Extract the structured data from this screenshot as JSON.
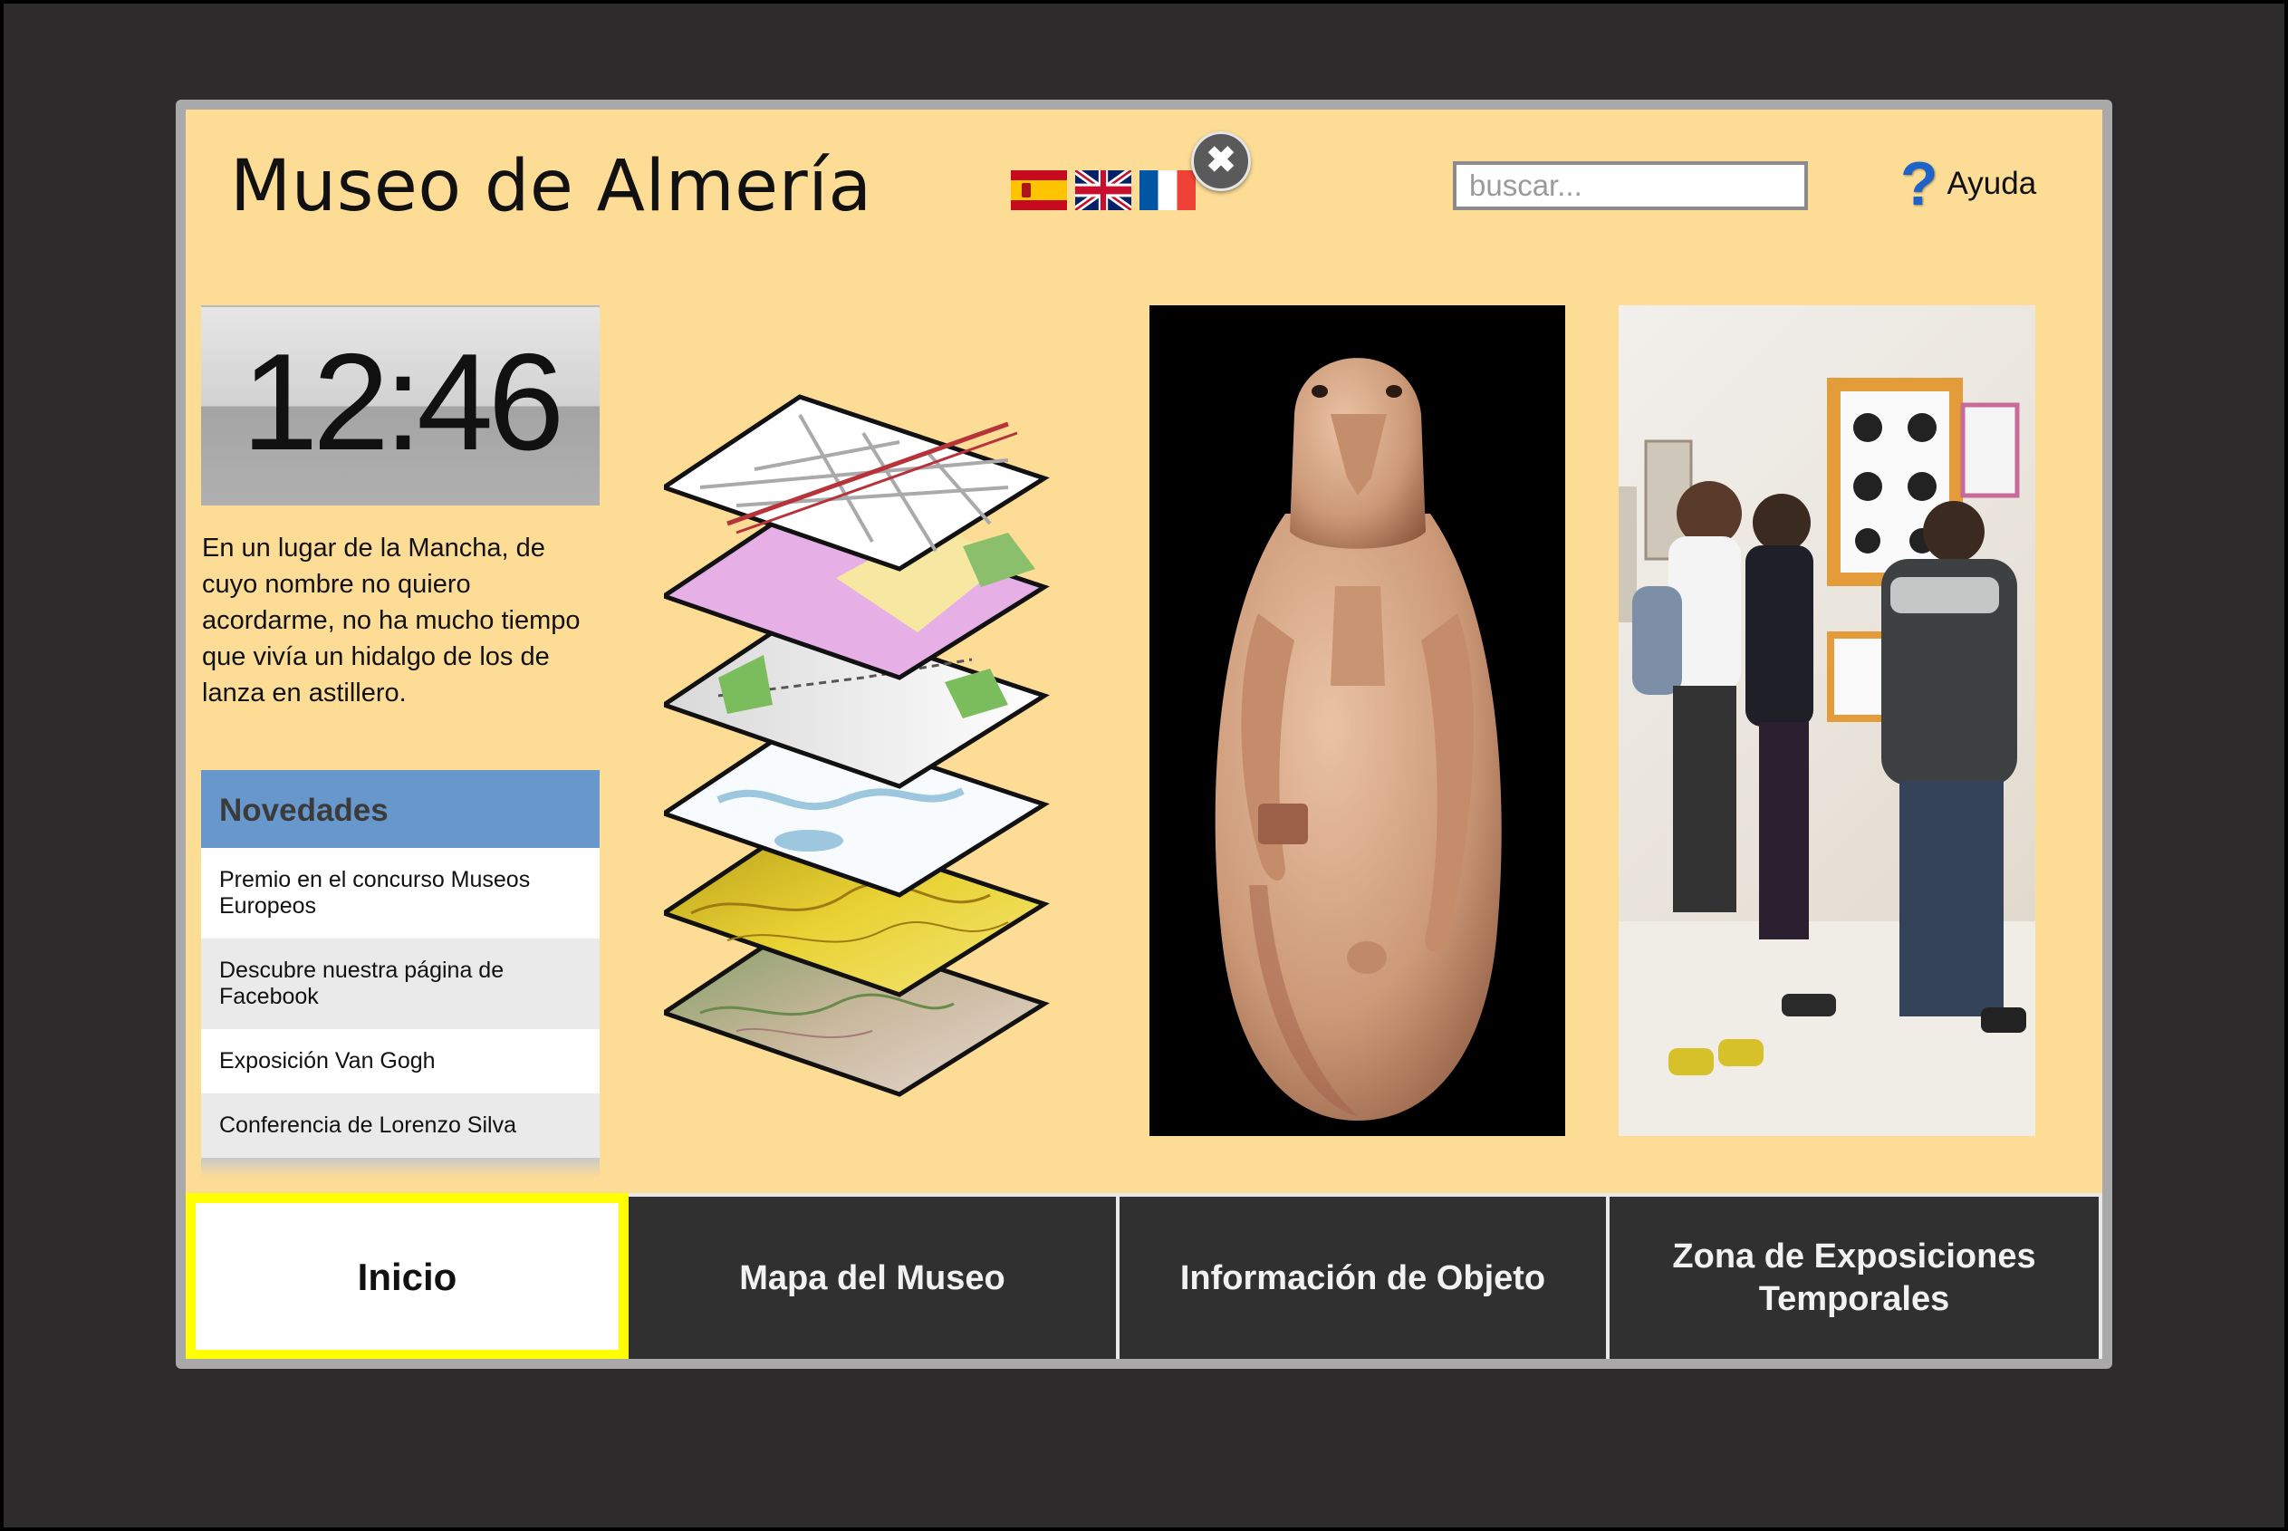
{
  "header": {
    "title": "Museo de Almería",
    "languages": [
      {
        "name": "spanish-flag-icon",
        "colors": [
          "#c60b1e",
          "#ffc400"
        ]
      },
      {
        "name": "uk-flag-icon",
        "colors": [
          "#012169",
          "#ffffff",
          "#c8102e"
        ]
      },
      {
        "name": "french-flag-icon",
        "colors": [
          "#0055a4",
          "#ffffff",
          "#ef4135"
        ]
      }
    ],
    "close_icon": "✖",
    "search_placeholder": "buscar...",
    "help_icon": "?",
    "help_label": "Ayuda"
  },
  "clock": {
    "time": "12:46"
  },
  "intro_text": "En un lugar de la Mancha, de cuyo nombre no quiero acordarme, no ha mucho tiempo que vivía un hidalgo de los de lanza en astillero.",
  "news": {
    "header": "Novedades",
    "items": [
      "Premio en el concurso Museos Europeos",
      "Descubre nuestra página de Facebook",
      "Exposición Van Gogh",
      "Conferencia de Lorenzo Silva"
    ]
  },
  "nav": {
    "tabs": [
      "Inicio",
      "Mapa del Museo",
      "Información de Objeto",
      "Zona de Exposiciones Temporales"
    ],
    "active_index": 0
  },
  "colors": {
    "background": "#fddc95",
    "frame": "#2d2b2c",
    "news_header": "#6897cc",
    "nav_tab": "#303030",
    "active_border": "#ffff00",
    "help_icon": "#1e63c8"
  }
}
